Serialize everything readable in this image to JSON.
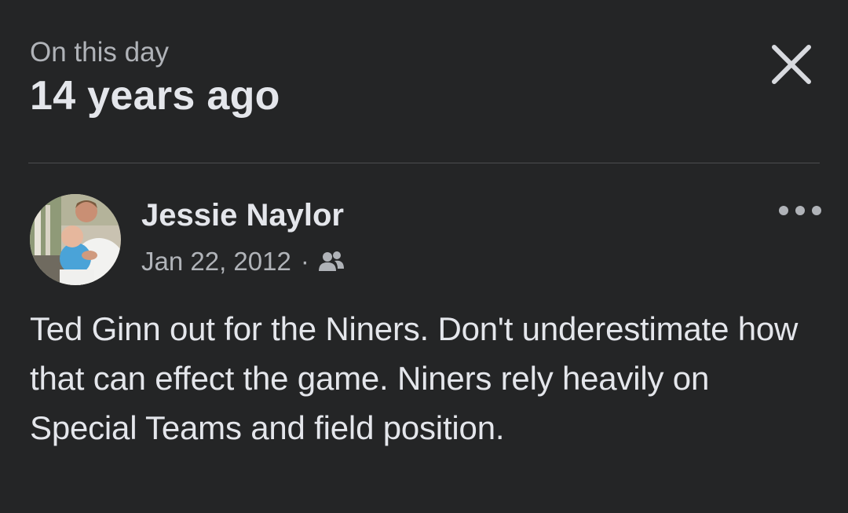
{
  "memory": {
    "label": "On this day",
    "title": "14 years ago"
  },
  "icons": {
    "close": "close-icon",
    "more": "more-horizontal-icon",
    "audience": "friends-icon"
  },
  "post": {
    "author": "Jessie Naylor",
    "date": "Jan 22, 2012",
    "separator": "·",
    "text": "Ted Ginn out for the Niners. Don't underestimate how that can effect the game. Niners rely heavily on Special Teams and field position."
  },
  "colors": {
    "background": "#242526",
    "primary_text": "#e4e6eb",
    "secondary_text": "#b0b3b8",
    "divider": "#4b4c4f"
  }
}
